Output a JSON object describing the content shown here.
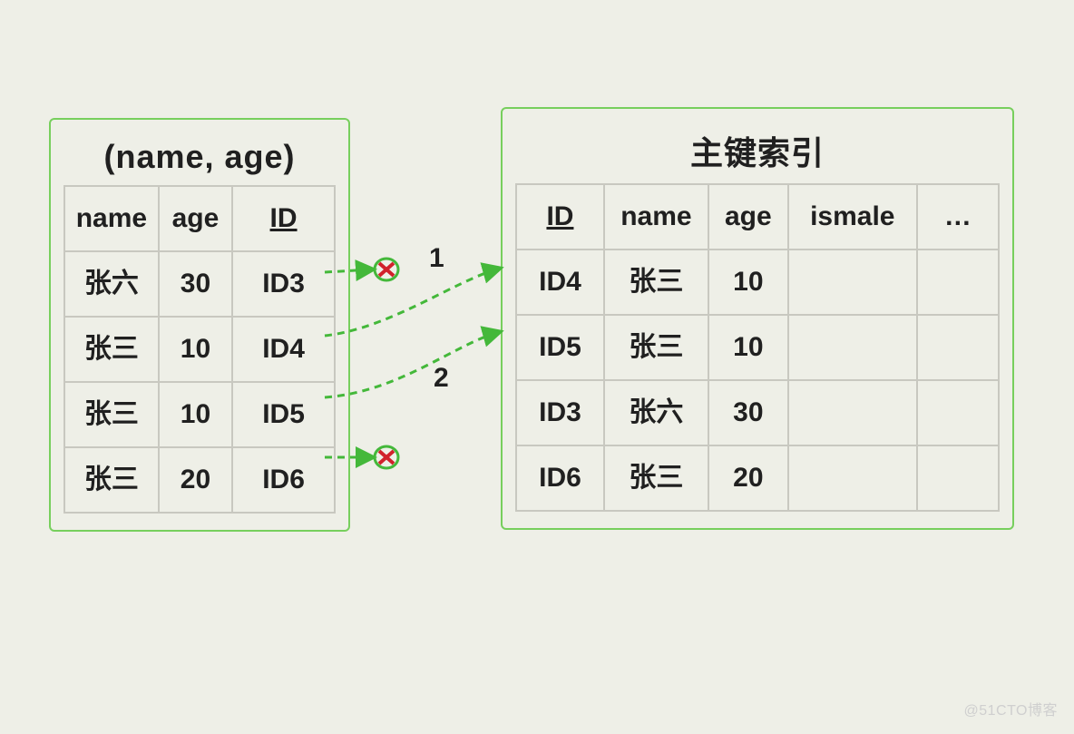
{
  "left": {
    "title": "(name, age)",
    "headers": [
      "name",
      "age",
      "ID"
    ],
    "rows": [
      {
        "name": "张六",
        "age": "30",
        "id": "ID3"
      },
      {
        "name": "张三",
        "age": "10",
        "id": "ID4"
      },
      {
        "name": "张三",
        "age": "10",
        "id": "ID5"
      },
      {
        "name": "张三",
        "age": "20",
        "id": "ID6"
      }
    ]
  },
  "right": {
    "title": "主键索引",
    "headers": [
      "ID",
      "name",
      "age",
      "ismale",
      "…"
    ],
    "rows": [
      {
        "id": "ID4",
        "name": "张三",
        "age": "10",
        "ismale": "",
        "ext": ""
      },
      {
        "id": "ID5",
        "name": "张三",
        "age": "10",
        "ismale": "",
        "ext": ""
      },
      {
        "id": "ID3",
        "name": "张六",
        "age": "30",
        "ismale": "",
        "ext": ""
      },
      {
        "id": "ID6",
        "name": "张三",
        "age": "20",
        "ismale": "",
        "ext": ""
      }
    ]
  },
  "annotations": {
    "arrow1_label": "1",
    "arrow2_label": "2"
  },
  "watermark": "@51CTO博客"
}
